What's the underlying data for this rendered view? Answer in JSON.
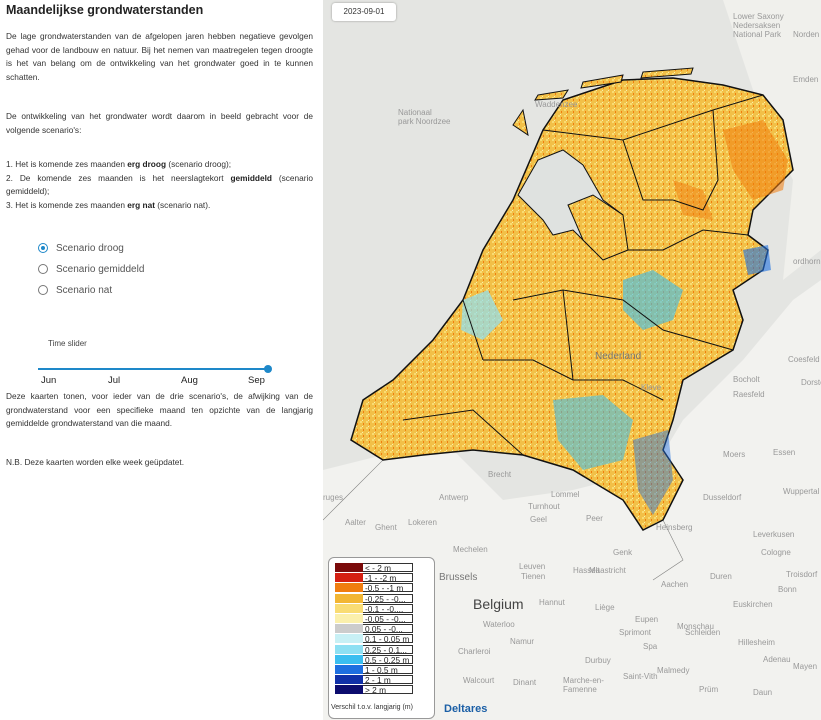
{
  "sidebar": {
    "title": "Maandelijkse grondwaterstanden",
    "intro": "De lage grondwaterstanden van de afgelopen jaren hebben negatieve gevolgen gehad voor de landbouw en natuur. Bij het nemen van maatregelen tegen droogte is het van belang om de ontwikkeling van het grondwater goed in te kunnen schatten.",
    "scenario_intro": "De ontwikkeling van het grondwater wordt daarom in beeld gebracht voor de volgende scenario's:",
    "scenario_list": [
      {
        "pre": "1. Het is komende zes maanden ",
        "bold": "erg droog",
        "post": " (scenario droog);"
      },
      {
        "pre": "2. De komende zes maanden is het neerslagtekort ",
        "bold": "gemiddeld",
        "post": " (scenario gemiddeld);"
      },
      {
        "pre": "3. Het is komende zes maanden ",
        "bold": "erg nat",
        "post": " (scenario nat)."
      }
    ],
    "radios": [
      {
        "label": "Scenario droog",
        "selected": true
      },
      {
        "label": "Scenario gemiddeld",
        "selected": false
      },
      {
        "label": "Scenario nat",
        "selected": false
      }
    ],
    "slider_label": "Time slider",
    "slider_months": [
      "Jun",
      "Jul",
      "Aug",
      "Sep"
    ],
    "slider_value": "Sep",
    "explanation": "Deze kaarten tonen, voor ieder van de drie scenario's, de afwijking van de grondwaterstand voor een specifieke maand ten opzichte van de langjarig gemiddelde grondwaterstand van die maand.",
    "note": "N.B. Deze kaarten worden elke week geüpdatet."
  },
  "map": {
    "date": "2023-09-01",
    "legend_caption": "Verschil t.o.v. langjarig (m)",
    "legend": [
      {
        "label": "< - 2 m",
        "color": "#7a0a0a"
      },
      {
        "label": "-1 - -2 m",
        "color": "#d41f11"
      },
      {
        "label": "-0.5 - -1 m",
        "color": "#f07d0f"
      },
      {
        "label": "-0.25 - -0...",
        "color": "#f2b633"
      },
      {
        "label": "-0.1 - -0....",
        "color": "#f9dc73"
      },
      {
        "label": "-0.05 - -0...",
        "color": "#fbf0ac"
      },
      {
        "label": "0.05 - -0...",
        "color": "#cccccc"
      },
      {
        "label": "0.1 - 0.05 m",
        "color": "#c8f0f5"
      },
      {
        "label": "0.25 - 0.1...",
        "color": "#8ee0f3"
      },
      {
        "label": "0.5 - 0.25 m",
        "color": "#3bbef0"
      },
      {
        "label": "1 - 0.5 m",
        "color": "#1e6fe0"
      },
      {
        "label": "2 - 1 m",
        "color": "#1030a8"
      },
      {
        "label": "> 2 m",
        "color": "#0c0c6e"
      }
    ],
    "labels": {
      "nedersaksen": "Lower Saxony\nNedersaksen\nNational Park",
      "emden": "Emden",
      "nordern": "Norden",
      "waddenzee": "Waddenzee",
      "noordzee": "Nationaal\npark Noordzee",
      "nordhorn": "ordhorn",
      "nederland": "Nederland",
      "kleve": "Kleve",
      "bocholt": "Bocholt",
      "raesfeld": "Raesfeld",
      "coesfeld": "Coesfeld",
      "dorsten": "Dorsten",
      "moers": "Moers",
      "essen": "Essen",
      "dusseldorf": "Dusseldorf",
      "wuppertal": "Wuppertal",
      "leverkusen": "Leverkusen",
      "cologne": "Cologne",
      "bonn": "Bonn",
      "duren": "Duren",
      "euskirchen": "Euskirchen",
      "troisdorf": "Troisdorf",
      "brugge": "ruges",
      "aalter": "Aalter",
      "ghent": "Ghent",
      "antwerp": "Antwerp",
      "brecht": "Brecht",
      "turnhout": "Turnhout",
      "lokeren": "Lokeren",
      "mechelen": "Mechelen",
      "hasselt": "Hasselt",
      "genk": "Genk",
      "leuven": "Leuven",
      "brussels": "Brussels",
      "belgium": "Belgium",
      "tienen": "Tienen",
      "maastricht": "Maastricht",
      "aachen": "Aachen",
      "liege": "Liège",
      "namur": "Namur",
      "charleroi": "Charleroi",
      "waterloo": "Waterloo",
      "hannut": "Hannut",
      "dinant": "Dinant",
      "durbuy": "Durbuy",
      "spa": "Spa",
      "malmedy": "Malmedy",
      "monschau": "Monschau",
      "schleiden": "Schleiden",
      "stvith": "Saint-Vith",
      "walcourt": "Walcourt",
      "marche": "Marche-en-\nFamenne",
      "hillesheim": "Hillesheim",
      "prum": "Prüm",
      "daun": "Daun",
      "mayen": "Mayen",
      "adenau": "Adenau",
      "eupen": "Eupen",
      "sprimont": "Sprimont",
      "heinsberg": "Heinsberg",
      "lommel": "Lommel",
      "geel": "Geel",
      "peer": "Peer"
    },
    "attribution": "Deltares"
  }
}
